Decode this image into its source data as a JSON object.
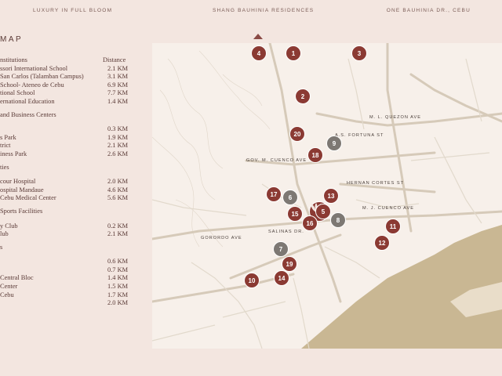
{
  "header": {
    "left": "LUXURY IN FULL BLOOM",
    "center": "SHANG BAUHINIA RESIDENCES",
    "right": "ONE BAUHINIA DR., CEBU"
  },
  "title": "MAP",
  "legend": {
    "column_header": {
      "name": "nstitutions",
      "distance": "Distance"
    },
    "schools": [
      {
        "name": "ssori International School",
        "distance": "2.1 KM"
      },
      {
        "name": "San Carlos (Talamban Campus)",
        "distance": "3.1 KM"
      },
      {
        "name": "School- Ateneo de Cebu",
        "distance": "6.9 KM"
      },
      {
        "name": "tional School",
        "distance": "7.7 KM"
      },
      {
        "name": "ernational Education",
        "distance": "1.4 KM"
      }
    ],
    "business_heading": "and Business Centers",
    "business": [
      {
        "name": "",
        "distance": "0.3 KM"
      },
      {
        "name": "s Park",
        "distance": "1.9 KM"
      },
      {
        "name": "trict",
        "distance": "2.1 KM"
      },
      {
        "name": "iness Park",
        "distance": "2.6 KM"
      }
    ],
    "hospitals_heading": "ties",
    "hospitals": [
      {
        "name": "cour Hospital",
        "distance": "2.0 KM"
      },
      {
        "name": "ospital Mandaue",
        "distance": "4.6 KM"
      },
      {
        "name": "Cebu Medical Center",
        "distance": "5.6 KM"
      }
    ],
    "sports_heading": "Sports Facilities",
    "sports": [
      {
        "name": "y Club",
        "distance": "0.2 KM"
      },
      {
        "name": "lub",
        "distance": "2.1 KM"
      }
    ],
    "retail_heading": "s",
    "retail": [
      {
        "name": "",
        "distance": "0.6 KM"
      },
      {
        "name": "",
        "distance": "0.7 KM"
      },
      {
        "name": "Central Bloc",
        "distance": "1.4 KM"
      },
      {
        "name": "Center",
        "distance": "1.5 KM"
      },
      {
        "name": "Cebu",
        "distance": "1.7 KM"
      },
      {
        "name": "",
        "distance": "2.0 KM"
      }
    ]
  },
  "map": {
    "streets": [
      {
        "id": "quezon",
        "label": "M. L. QUEZON AVE"
      },
      {
        "id": "fortuna",
        "label": "A.S. FORTUNA ST"
      },
      {
        "id": "cuenco-gov",
        "label": "GOV. M. CUENCO AVE"
      },
      {
        "id": "cortes",
        "label": "HERNAN CORTES ST"
      },
      {
        "id": "cuenco-mj",
        "label": "M. J. CUENCO AVE"
      },
      {
        "id": "salinas",
        "label": "SALINAS DR."
      },
      {
        "id": "gorordo",
        "label": "GORORDO AVE"
      }
    ],
    "pins": [
      {
        "id": "4",
        "label": "4",
        "color": "red"
      },
      {
        "id": "1",
        "label": "1",
        "color": "red"
      },
      {
        "id": "3",
        "label": "3",
        "color": "red"
      },
      {
        "id": "2",
        "label": "2",
        "color": "red"
      },
      {
        "id": "20",
        "label": "20",
        "color": "red"
      },
      {
        "id": "9",
        "label": "9",
        "color": "gray"
      },
      {
        "id": "18",
        "label": "18",
        "color": "red"
      },
      {
        "id": "17",
        "label": "17",
        "color": "red"
      },
      {
        "id": "6",
        "label": "6",
        "color": "gray"
      },
      {
        "id": "13",
        "label": "13",
        "color": "red"
      },
      {
        "id": "15",
        "label": "15",
        "color": "red"
      },
      {
        "id": "5",
        "label": "5",
        "color": "red"
      },
      {
        "id": "8",
        "label": "8",
        "color": "gray"
      },
      {
        "id": "16",
        "label": "16",
        "color": "red"
      },
      {
        "id": "11",
        "label": "11",
        "color": "red"
      },
      {
        "id": "12",
        "label": "12",
        "color": "red"
      },
      {
        "id": "7",
        "label": "7",
        "color": "gray"
      },
      {
        "id": "19",
        "label": "19",
        "color": "red"
      },
      {
        "id": "14",
        "label": "14",
        "color": "red"
      },
      {
        "id": "10",
        "label": "10",
        "color": "red"
      }
    ],
    "colors": {
      "pin_red": "#8b3a33",
      "pin_gray": "#7d7873",
      "water": "#c9b793",
      "roads": "#d8cfc2"
    }
  }
}
